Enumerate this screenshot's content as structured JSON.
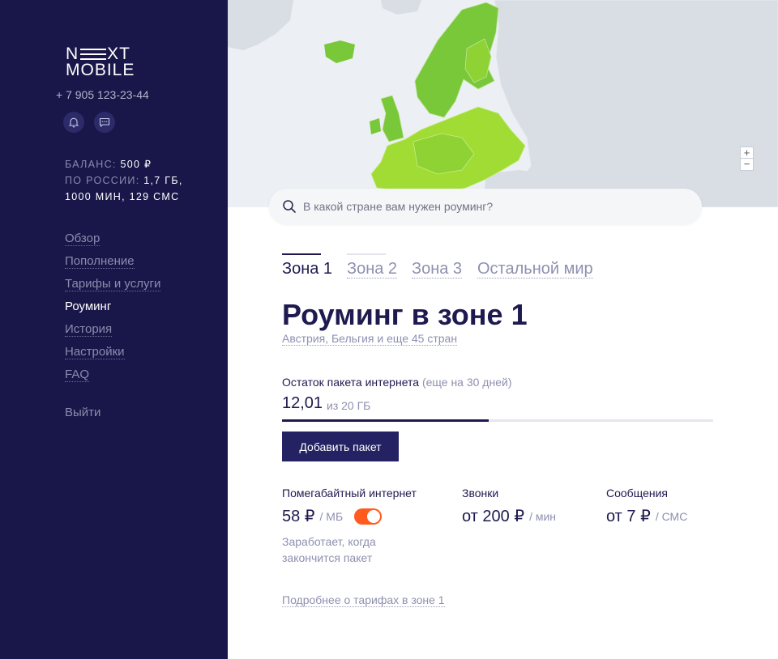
{
  "brand": {
    "logo_top_left": "N",
    "logo_top_right": "XT",
    "logo_bottom": "MOBILE"
  },
  "user": {
    "phone": "+ 7 905 123-23-44"
  },
  "balance": {
    "balance_label": "БАЛАНС:",
    "balance_value": "500 ₽",
    "russia_label": "ПО РОССИИ:",
    "russia_value_line1": "1,7 ГБ,",
    "russia_value_line2": "1000 МИН, 129 СМС"
  },
  "nav": {
    "items": [
      {
        "label": "Обзор"
      },
      {
        "label": "Пополнение"
      },
      {
        "label": "Тарифы и услуги"
      },
      {
        "label": "Роуминг",
        "active": true
      },
      {
        "label": "История"
      },
      {
        "label": "Настройки"
      },
      {
        "label": "FAQ"
      }
    ],
    "logout": "Выйти"
  },
  "map": {
    "zoom_in": "+",
    "zoom_out": "−",
    "colors": {
      "ocean": "#eceff3",
      "land": "#d9dde4",
      "zone1_dark": "#78c83a",
      "zone1_light": "#a0dc34"
    }
  },
  "search": {
    "placeholder": "В какой стране вам нужен роуминг?"
  },
  "tabs": [
    {
      "label": "Зона 1",
      "active": true
    },
    {
      "label": "Зона 2"
    },
    {
      "label": "Зона 3"
    },
    {
      "label": "Остальной мир"
    }
  ],
  "zone": {
    "title": "Роуминг в зоне 1",
    "countries": "Австрия, Бельгия и еще 45 стран"
  },
  "package": {
    "label": "Остаток пакета интернета",
    "days_note": "(еще на 30 дней)",
    "remaining": "12,01",
    "total": "из 20 ГБ",
    "fraction_remaining": 0.48
  },
  "add_button": "Добавить пакет",
  "rates": {
    "internet": {
      "title": "Помегабайтный интернет",
      "price": "58 ₽",
      "unit": "/ МБ",
      "toggle_on": true,
      "note": "Заработает, когда закончится пакет"
    },
    "calls": {
      "title": "Звонки",
      "price": "от 200 ₽",
      "unit": "/ мин"
    },
    "sms": {
      "title": "Сообщения",
      "price": "от 7 ₽",
      "unit": "/ СМС"
    }
  },
  "details_link": "Подробнее о тарифах в зоне 1",
  "colors": {
    "sidebar": "#191749",
    "accent": "#ff5b1f",
    "primary": "#242262"
  }
}
